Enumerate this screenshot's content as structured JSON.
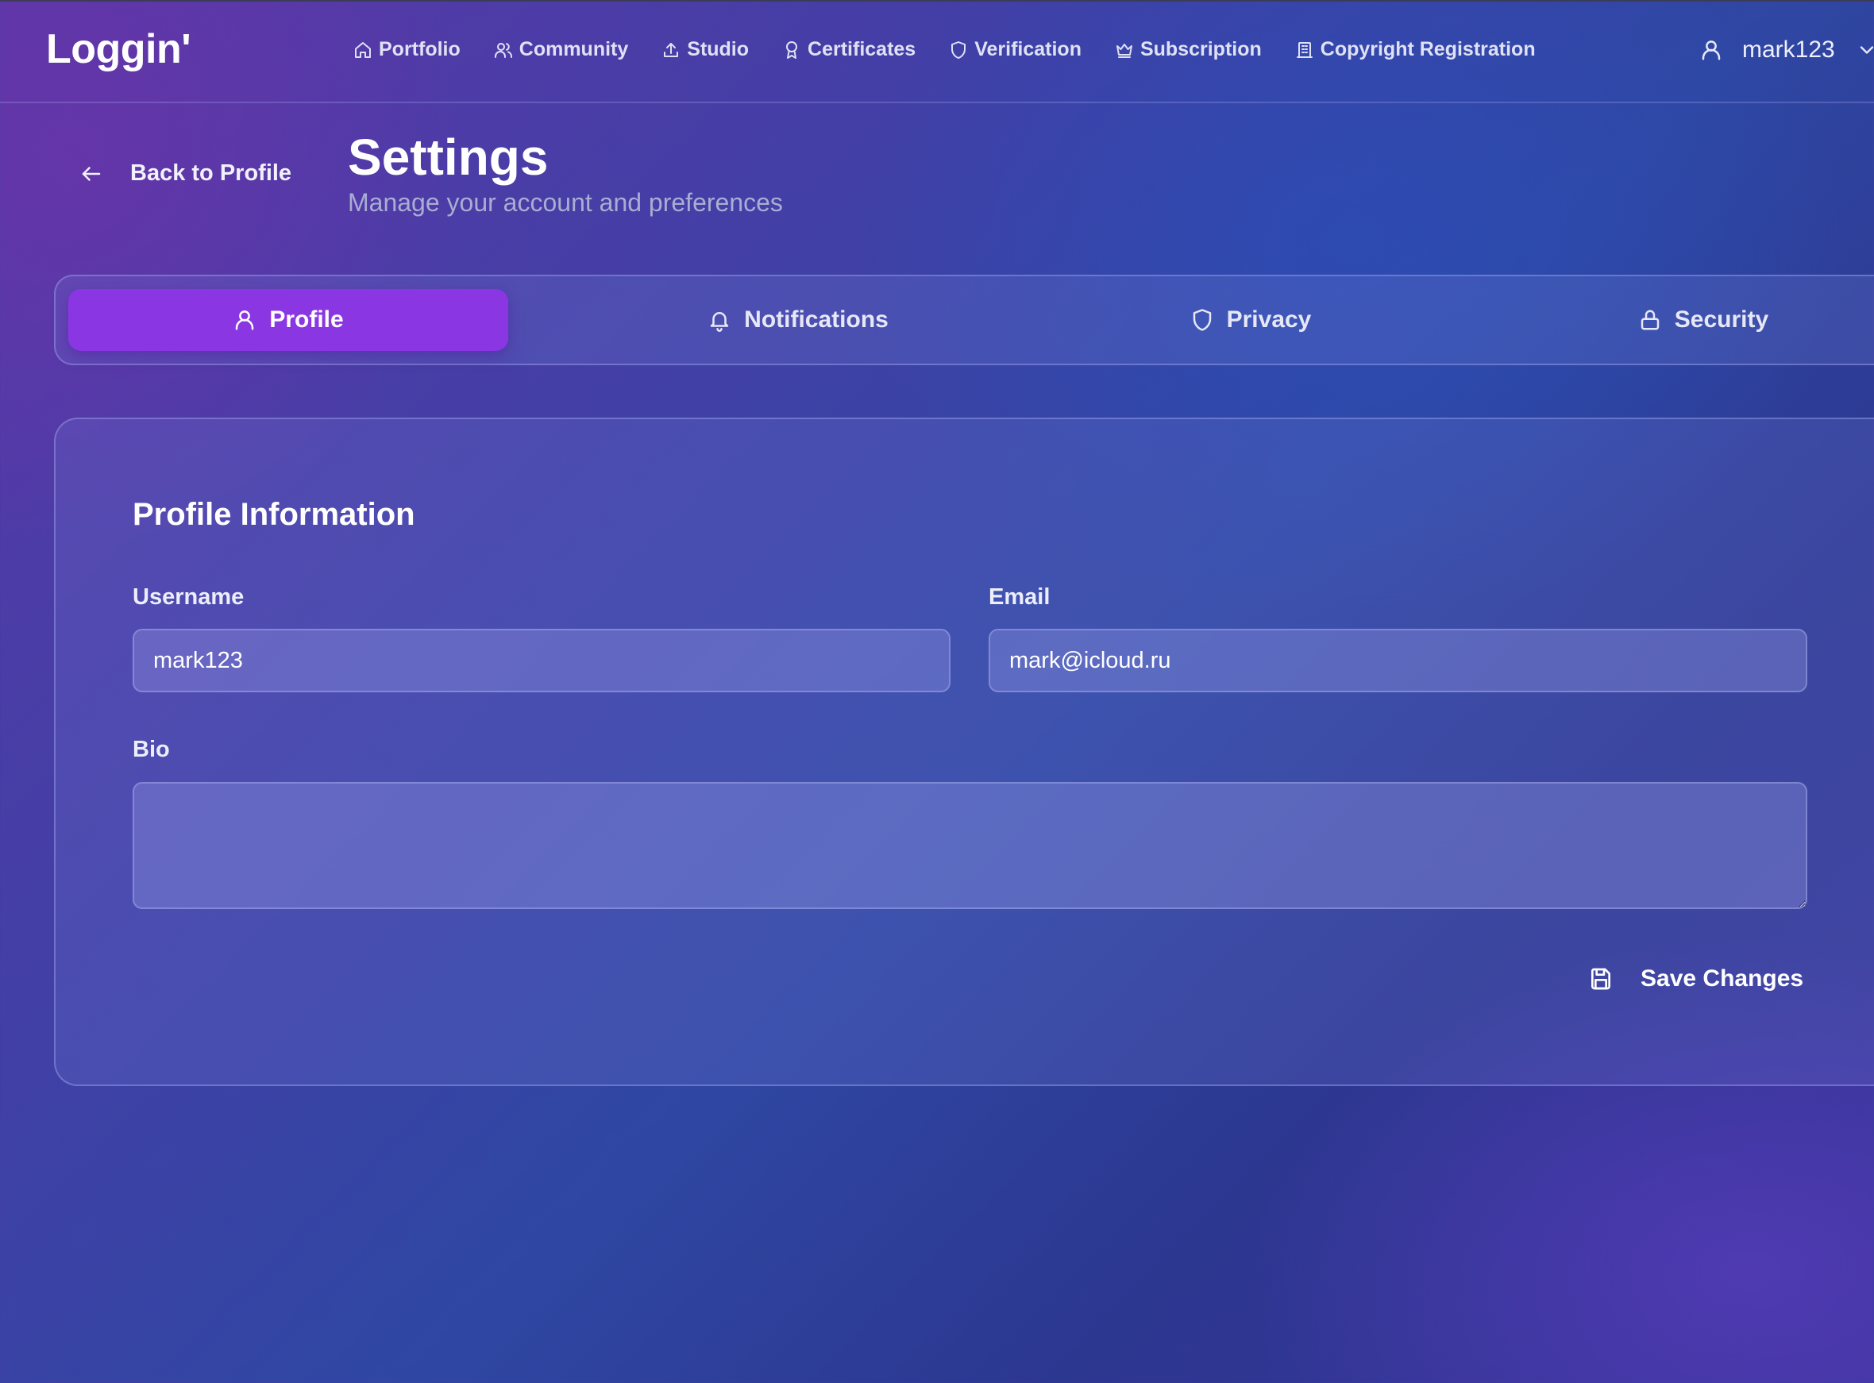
{
  "app": {
    "logo": "Loggin'"
  },
  "nav": {
    "items": [
      {
        "label": "Portfolio",
        "icon": "home-icon"
      },
      {
        "label": "Community",
        "icon": "users-icon"
      },
      {
        "label": "Studio",
        "icon": "upload-icon"
      },
      {
        "label": "Certificates",
        "icon": "award-icon"
      },
      {
        "label": "Verification",
        "icon": "shield-icon"
      },
      {
        "label": "Subscription",
        "icon": "crown-icon"
      },
      {
        "label": "Copyright Registration",
        "icon": "building-icon"
      }
    ]
  },
  "user": {
    "name": "mark123",
    "icon": "user-icon",
    "menu_icon": "chevron-down-icon"
  },
  "header": {
    "back_label": "Back to Profile",
    "title": "Settings",
    "subtitle": "Manage your account and preferences"
  },
  "tabs": [
    {
      "label": "Profile",
      "icon": "user-icon",
      "active": true
    },
    {
      "label": "Notifications",
      "icon": "bell-icon",
      "active": false
    },
    {
      "label": "Privacy",
      "icon": "shield-icon",
      "active": false
    },
    {
      "label": "Security",
      "icon": "lock-icon",
      "active": false
    }
  ],
  "profile_form": {
    "title": "Profile Information",
    "username_label": "Username",
    "username_value": "mark123",
    "email_label": "Email",
    "email_value": "mark@icloud.ru",
    "bio_label": "Bio",
    "bio_value": "",
    "save_label": "Save Changes"
  },
  "colors": {
    "accent": "#8a37e3",
    "background_start": "#5a38a8",
    "background_end": "#2c3790"
  }
}
